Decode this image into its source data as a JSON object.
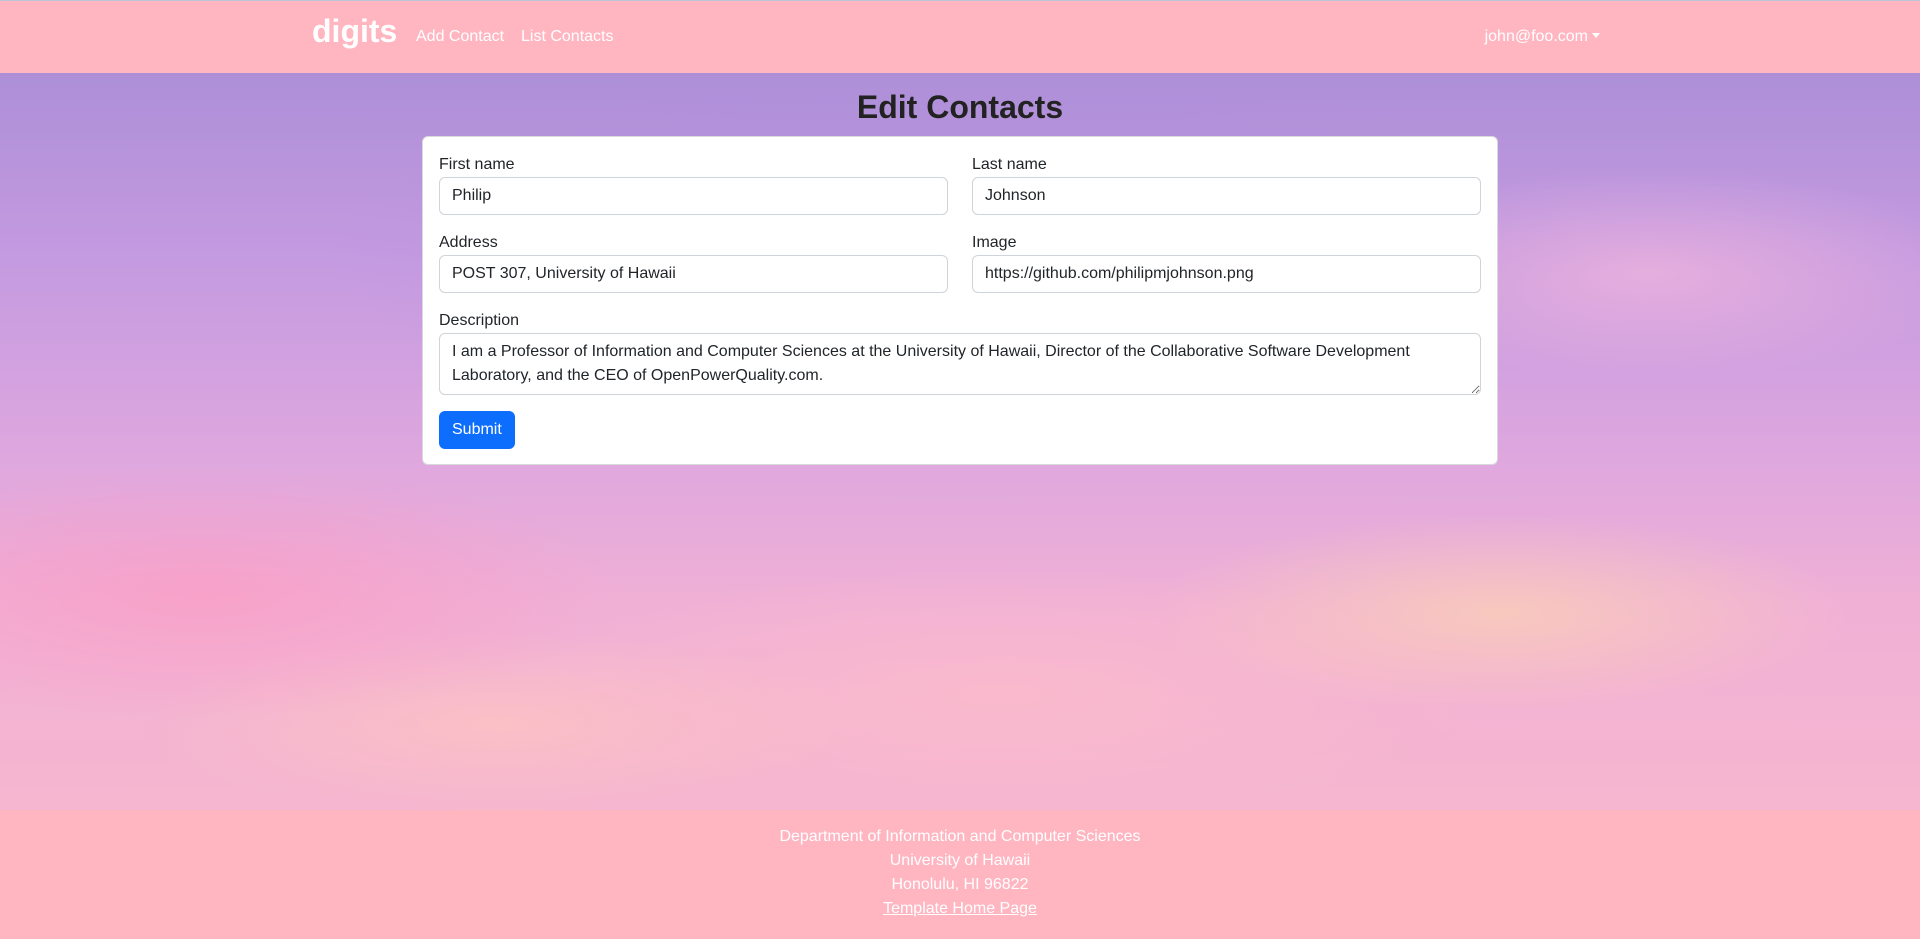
{
  "navbar": {
    "brand": "digits",
    "links": [
      "Add Contact",
      "List Contacts"
    ],
    "user": "john@foo.com"
  },
  "page": {
    "title": "Edit Contacts"
  },
  "form": {
    "first_name": {
      "label": "First name",
      "value": "Philip"
    },
    "last_name": {
      "label": "Last name",
      "value": "Johnson"
    },
    "address": {
      "label": "Address",
      "value": "POST 307, University of Hawaii"
    },
    "image": {
      "label": "Image",
      "value": "https://github.com/philipmjohnson.png"
    },
    "description": {
      "label": "Description",
      "value": "I am a Professor of Information and Computer Sciences at the University of Hawaii, Director of the Collaborative Software Development Laboratory, and the CEO of OpenPowerQuality.com."
    },
    "submit_label": "Submit",
    "submit_color": "#0d6efd"
  },
  "footer": {
    "lines": [
      "Department of Information and Computer Sciences",
      "University of Hawaii",
      "Honolulu, HI 96822"
    ],
    "link": "Template Home Page"
  },
  "colors": {
    "navbar_bg": "#ffb6c1",
    "footer_bg": "#ffb6c1"
  }
}
